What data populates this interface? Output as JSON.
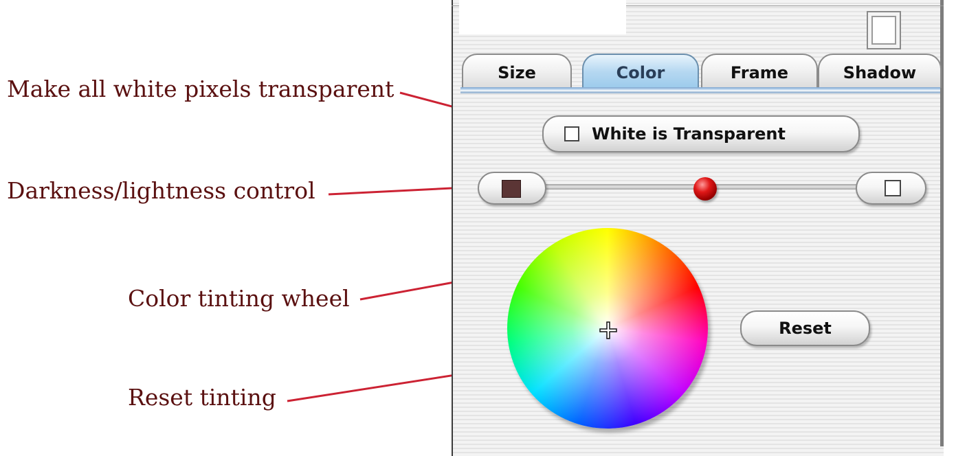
{
  "callouts": {
    "white_transparent": "Make all white pixels transparent",
    "darkness_lightness": "Darkness/lightness control",
    "color_wheel": "Color tinting wheel",
    "reset_tinting": "Reset tinting"
  },
  "tabs": [
    {
      "label": "Size"
    },
    {
      "label": "Color",
      "active": true
    },
    {
      "label": "Frame"
    },
    {
      "label": "Shadow"
    }
  ],
  "color_panel": {
    "white_transparent_label": "White is Transparent",
    "white_transparent_checked": false,
    "lightness_level": 0.5,
    "reset_label": "Reset"
  },
  "colors": {
    "callout_text": "#5a1010",
    "callout_line": "#cc2233",
    "active_tab": "#9ccbec",
    "dark_swatch": "#5b3535"
  },
  "icons": [
    "checkbox-icon",
    "dark-swatch-icon",
    "light-swatch-icon",
    "crosshair-icon",
    "window-box-icon"
  ]
}
